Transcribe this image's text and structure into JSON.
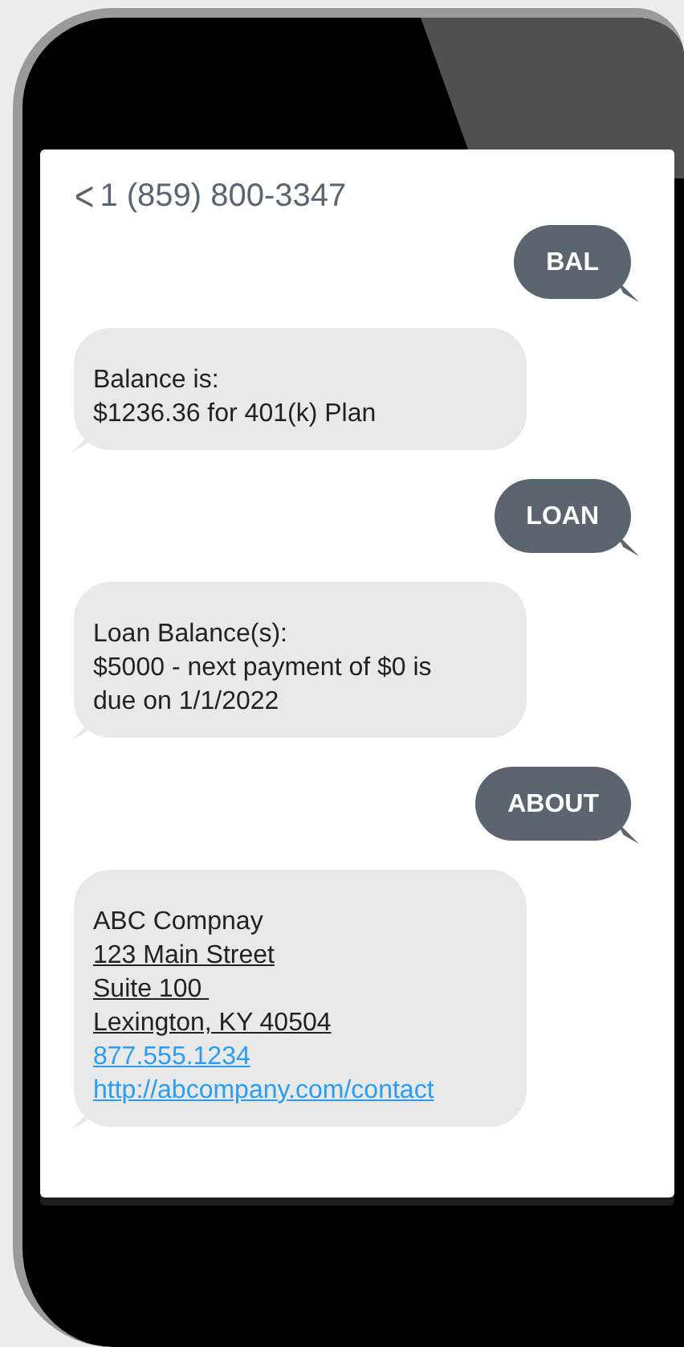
{
  "header": {
    "back": "<",
    "contact": "1 (859) 800-3347"
  },
  "messages": [
    {
      "kind": "sent",
      "lines": [
        {
          "kind": "plain",
          "text": "BAL"
        }
      ]
    },
    {
      "kind": "received",
      "lines": [
        {
          "kind": "plain",
          "text": "Balance is:"
        },
        {
          "kind": "plain",
          "text": "$1236.36 for 401(k) Plan"
        }
      ]
    },
    {
      "kind": "sent",
      "lines": [
        {
          "kind": "plain",
          "text": "LOAN"
        }
      ]
    },
    {
      "kind": "received",
      "lines": [
        {
          "kind": "plain",
          "text": "Loan Balance(s):"
        },
        {
          "kind": "plain",
          "text": "$5000 - next payment of $0 is"
        },
        {
          "kind": "plain",
          "text": "due on 1/1/2022"
        }
      ]
    },
    {
      "kind": "sent",
      "lines": [
        {
          "kind": "plain",
          "text": "ABOUT"
        }
      ]
    },
    {
      "kind": "received",
      "lines": [
        {
          "kind": "plain",
          "text": "ABC Compnay"
        },
        {
          "kind": "address",
          "text": "123 Main Street"
        },
        {
          "kind": "address",
          "text": "Suite 100 "
        },
        {
          "kind": "address",
          "text": "Lexington, KY 40504"
        },
        {
          "kind": "phone",
          "text": "877.555.1234"
        },
        {
          "kind": "url",
          "text": "http://abcompany.com/contact"
        }
      ]
    }
  ]
}
